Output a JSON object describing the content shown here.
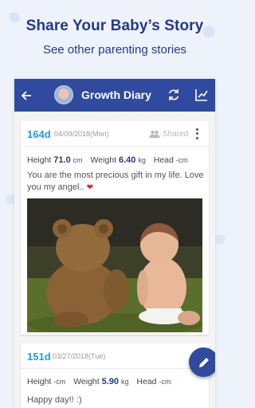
{
  "promo": {
    "headline": "Share Your Baby’s Story",
    "subheadline": "See other parenting stories"
  },
  "appbar": {
    "title": "Growth Diary",
    "icons": [
      "back-arrow-icon",
      "baby-avatar",
      "sync-icon",
      "growth-chart-icon"
    ]
  },
  "entries": [
    {
      "days": "164d",
      "date": "04/09/2018(Mon)",
      "shared_label": "Shared",
      "height_label": "Height",
      "height_value": "71.0",
      "height_unit": "cm",
      "weight_label": "Weight",
      "weight_value": "6.40",
      "weight_unit": "kg",
      "head_label": "Head",
      "head_value": "-",
      "head_unit": "cm",
      "note": "You are the most precious gift in my life. Love you my angel..",
      "has_photo": true
    },
    {
      "days": "151d",
      "date": "03/27/2018(Tue)",
      "height_label": "Height",
      "height_value": "-",
      "height_unit": "cm",
      "weight_label": "Weight",
      "weight_value": "5.90",
      "weight_unit": "kg",
      "head_label": "Head",
      "head_value": "-",
      "head_unit": "cm",
      "note": "Happy day!! :)",
      "has_photo": false
    }
  ],
  "colors": {
    "appbar": "#2f4a9e",
    "accent_days": "#1b9fd6",
    "value": "#243a8a",
    "background": "#eef3fb"
  }
}
